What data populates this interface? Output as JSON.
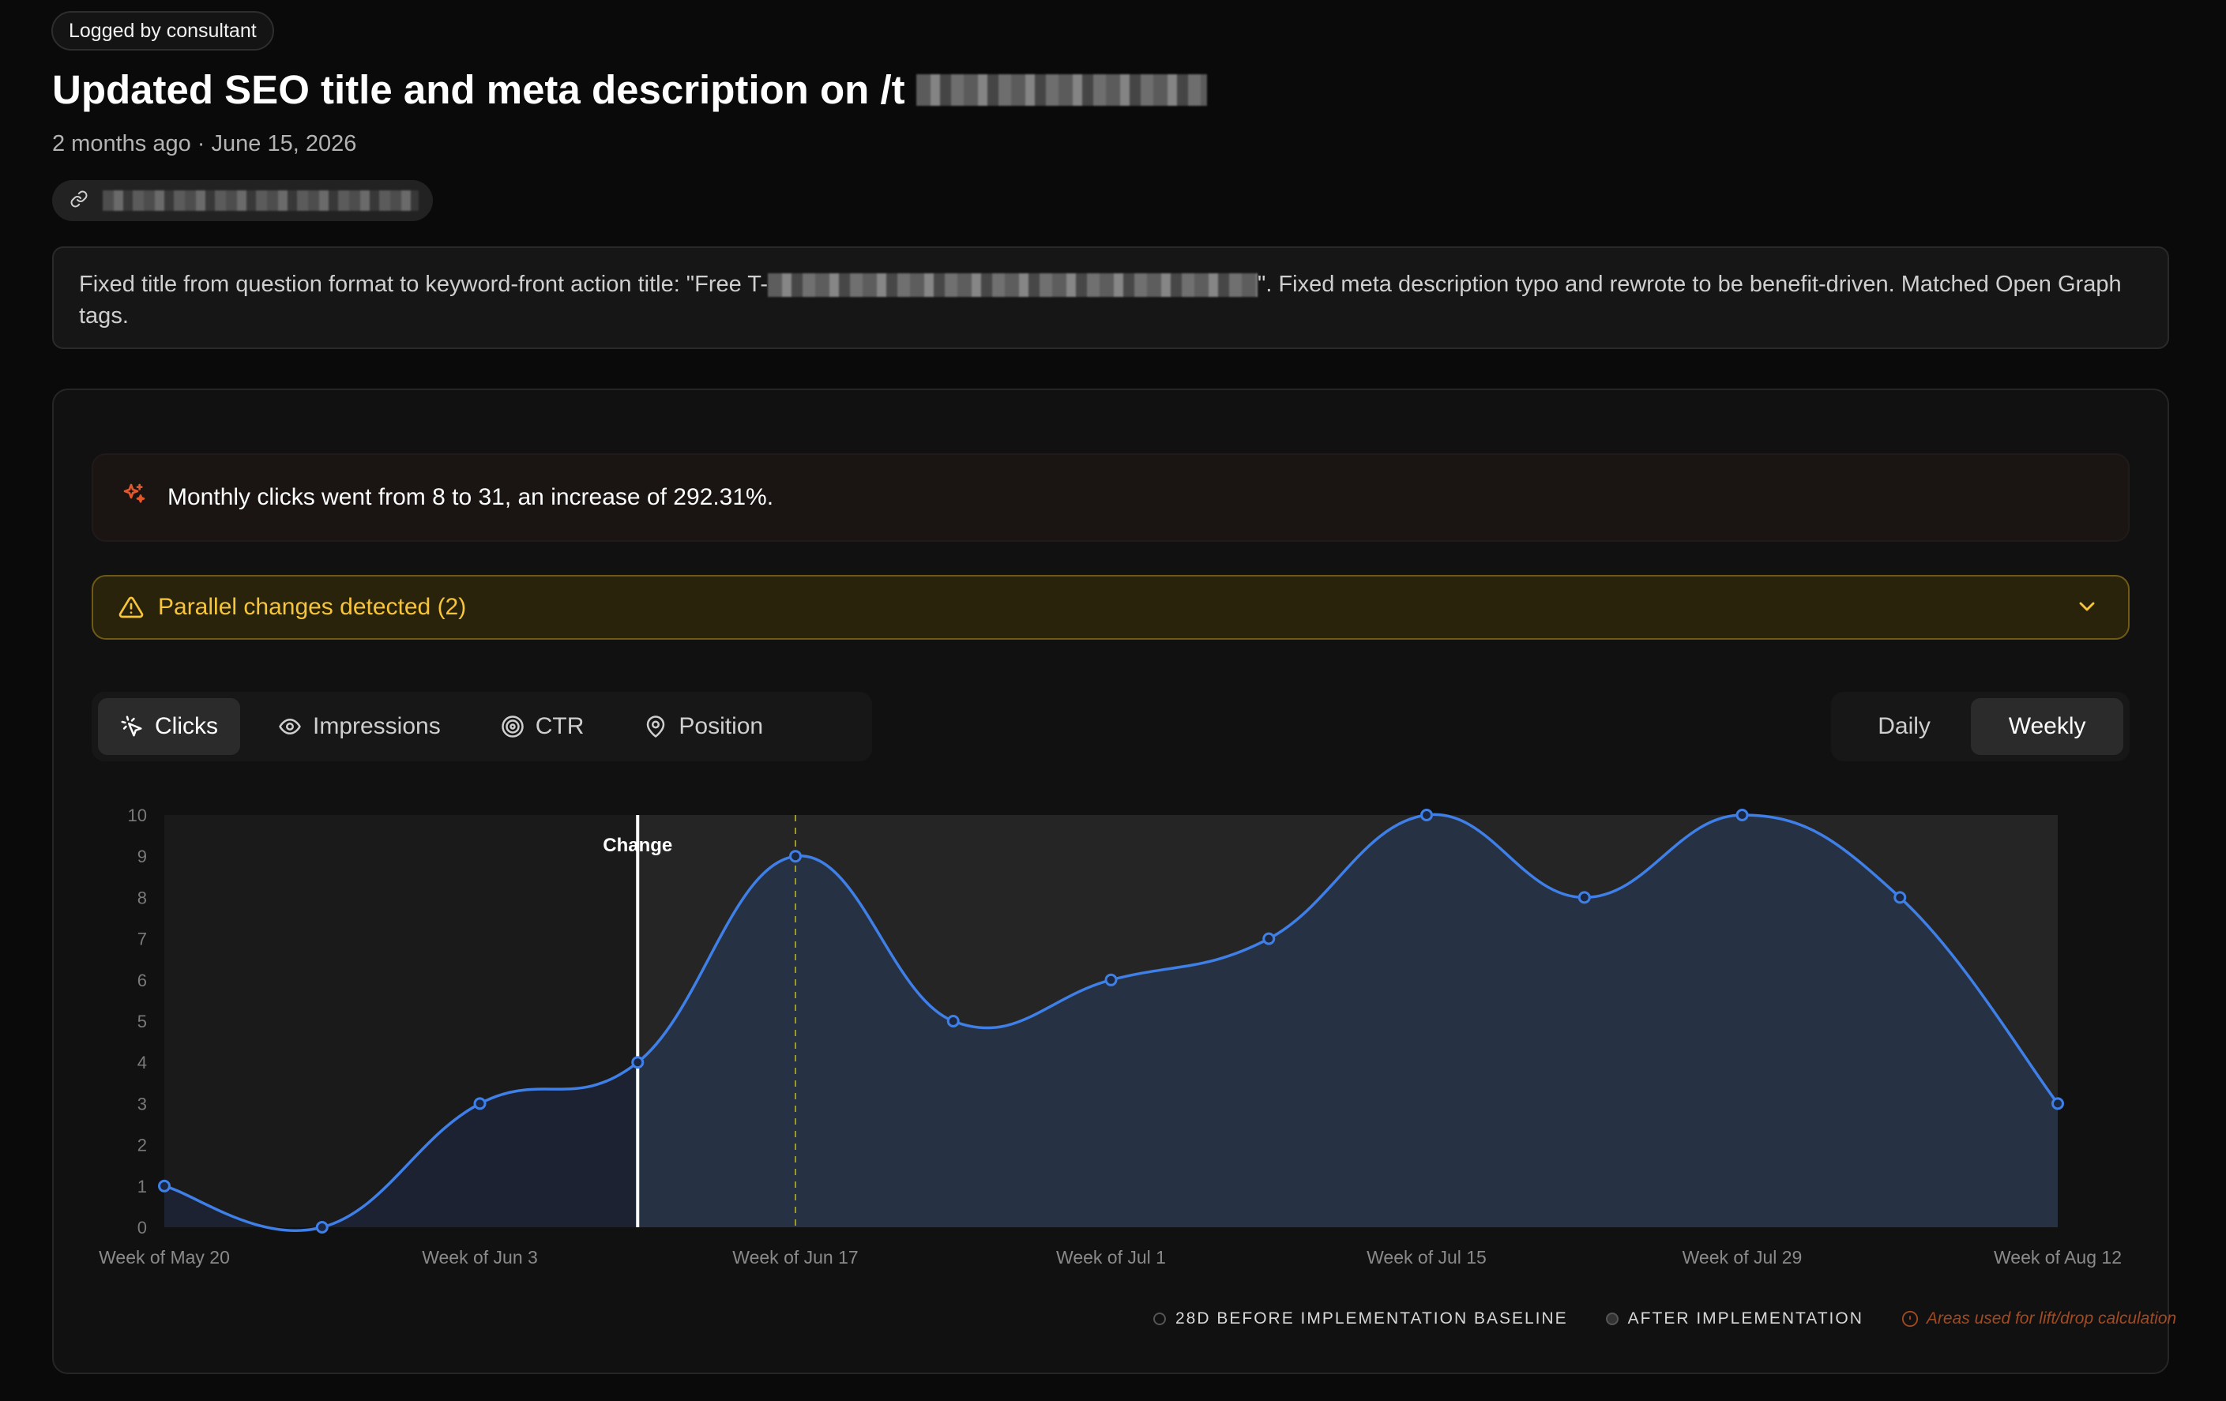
{
  "header": {
    "badge": "Logged by consultant",
    "title": "Updated SEO title and meta description on /t",
    "meta": "2 months ago · June 15, 2026"
  },
  "description": {
    "before_redaction": "Fixed title from question format to keyword-front action title: \"Free T-",
    "after_redaction": "\". Fixed meta description typo and rewrote to be benefit-driven. Matched Open Graph tags."
  },
  "insight": {
    "text": "Monthly clicks went from 8 to 31, an increase of 292.31%."
  },
  "warning": {
    "text": "Parallel changes detected (2)"
  },
  "metric_tabs": [
    {
      "label": "Clicks",
      "icon": "cursor-click-icon",
      "active": true
    },
    {
      "label": "Impressions",
      "icon": "eye-icon",
      "active": false
    },
    {
      "label": "CTR",
      "icon": "target-icon",
      "active": false
    },
    {
      "label": "Position",
      "icon": "map-pin-icon",
      "active": false
    }
  ],
  "granularity": [
    {
      "label": "Daily",
      "active": false
    },
    {
      "label": "Weekly",
      "active": true
    }
  ],
  "colors": {
    "line": "#3f7fe8",
    "warning": "#f7c53b",
    "accent": "#e2572b"
  },
  "chart_data": {
    "type": "area",
    "x_ticks": [
      "Week of May 20",
      "Week of Jun 3",
      "Week of Jun 17",
      "Week of Jul 1",
      "Week of Jul 15",
      "Week of Jul 29",
      "Week of Aug 12"
    ],
    "ylim": [
      0,
      10
    ],
    "yticks": [
      0,
      1,
      2,
      3,
      4,
      5,
      6,
      7,
      8,
      9,
      10
    ],
    "series": [
      {
        "values": [
          1,
          0,
          3,
          4,
          9,
          5,
          6,
          7,
          10,
          8,
          10,
          8,
          3
        ]
      }
    ],
    "change_marker": {
      "label": "Change",
      "index": 3
    },
    "dashed_marker_index": 4,
    "grid": false
  },
  "legend": {
    "before": "28D BEFORE IMPLEMENTATION BASELINE",
    "after": "AFTER IMPLEMENTATION",
    "note": "Areas used for lift/drop calculation"
  }
}
